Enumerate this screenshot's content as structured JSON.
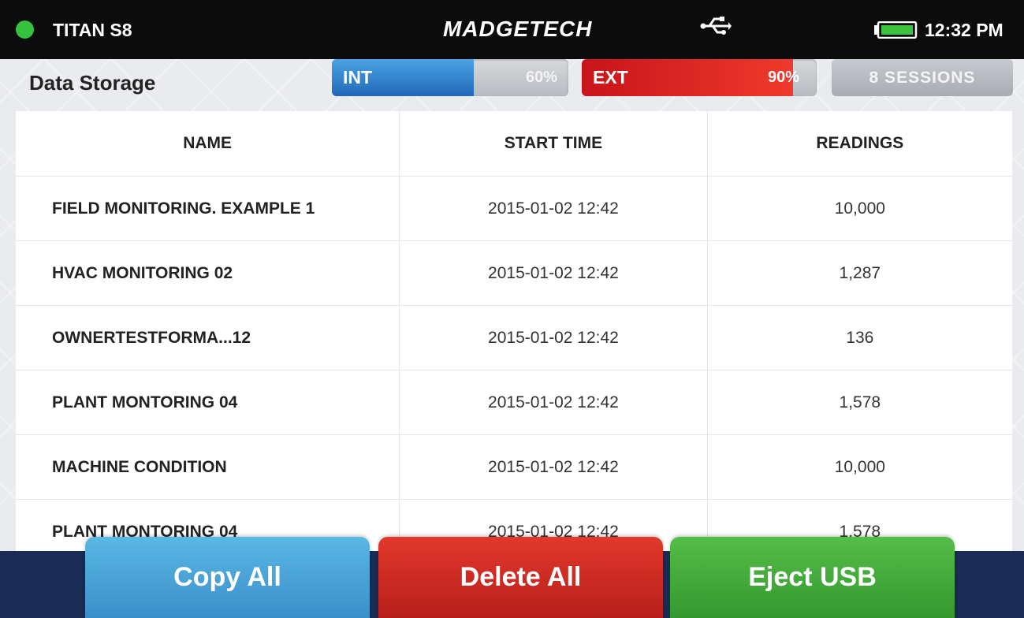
{
  "status_bar": {
    "device": "TITAN S8",
    "brand": "MADGETECH",
    "time": "12:32 PM",
    "status_color": "#35c23c",
    "icons": [
      "usb-icon",
      "battery-icon"
    ]
  },
  "header": {
    "title": "Data Storage",
    "int": {
      "label": "INT",
      "percent_text": "60%",
      "fill_fraction": 0.6
    },
    "ext": {
      "label": "EXT",
      "percent_text": "90%",
      "fill_fraction": 0.9
    },
    "sessions": "8 SESSIONS"
  },
  "table": {
    "columns": [
      "NAME",
      "START TIME",
      "READINGS"
    ],
    "rows": [
      {
        "name": "FIELD MONITORING. EXAMPLE 1",
        "start": "2015-01-02 12:42",
        "readings": "10,000"
      },
      {
        "name": "HVAC MONITORING 02",
        "start": "2015-01-02 12:42",
        "readings": "1,287"
      },
      {
        "name": "OWNERTESTFORMA...12",
        "start": "2015-01-02 12:42",
        "readings": "136"
      },
      {
        "name": "PLANT MONTORING 04",
        "start": "2015-01-02 12:42",
        "readings": "1,578"
      },
      {
        "name": "MACHINE CONDITION",
        "start": "2015-01-02 12:42",
        "readings": "10,000"
      },
      {
        "name": "PLANT MONTORING 04",
        "start": "2015-01-02 12:42",
        "readings": "1,578"
      }
    ]
  },
  "actions": {
    "copy_all": "Copy All",
    "delete_all": "Delete All",
    "eject_usb": "Eject USB"
  },
  "colors": {
    "copy": "#4aa6d8",
    "delete": "#cf2a22",
    "eject": "#45ab3c",
    "bottom_bar": "#1a2c55"
  }
}
